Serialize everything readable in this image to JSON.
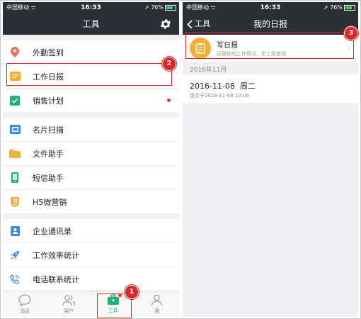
{
  "status": {
    "carrier": "中国移动",
    "time": "16:33",
    "battery": "76%"
  },
  "left": {
    "title": "工具",
    "items": [
      {
        "label": "外勤签到",
        "icon": "location-pin-icon",
        "color": "#f26b5b"
      },
      {
        "label": "工作日报",
        "icon": "daily-report-icon",
        "color": "#f2b134"
      },
      {
        "label": "销售计划",
        "icon": "checklist-icon",
        "color": "#1fb37c"
      },
      {
        "label": "名片扫描",
        "icon": "scan-icon",
        "color": "#3b8de8"
      },
      {
        "label": "文件助手",
        "icon": "folder-icon",
        "color": "#f2b134"
      },
      {
        "label": "短信助手",
        "icon": "phone-icon",
        "color": "#1fb37c"
      },
      {
        "label": "H5微营销",
        "icon": "h5-icon",
        "color": "#f2a634"
      },
      {
        "label": "企业通讯录",
        "icon": "contacts-icon",
        "color": "#3b8de8"
      },
      {
        "label": "工作效率统计",
        "icon": "rocket-icon",
        "color": "#3b8de8"
      },
      {
        "label": "电话联系统计",
        "icon": "call-icon",
        "color": "#3b8de8"
      }
    ],
    "tabs": [
      {
        "label": "消息",
        "icon": "message-icon"
      },
      {
        "label": "客户",
        "icon": "customers-icon"
      },
      {
        "label": "工具",
        "icon": "toolbox-icon"
      },
      {
        "label": "我",
        "icon": "profile-icon"
      }
    ]
  },
  "right": {
    "back_label": "工具",
    "title": "我的日报",
    "write_title": "写日报",
    "write_sub": "记录你的工作情况，供上级查阅",
    "month": "2016年11月",
    "entry_date": "2016-11-08",
    "entry_weekday": "周二",
    "entry_submitted": "提交于2016-11-08 10:09"
  },
  "callouts": {
    "one": "1",
    "two": "2",
    "three": "3"
  },
  "colors": {
    "accent": "#1fb37c",
    "highlight": "#e02424",
    "navbar": "#2b2f38"
  }
}
